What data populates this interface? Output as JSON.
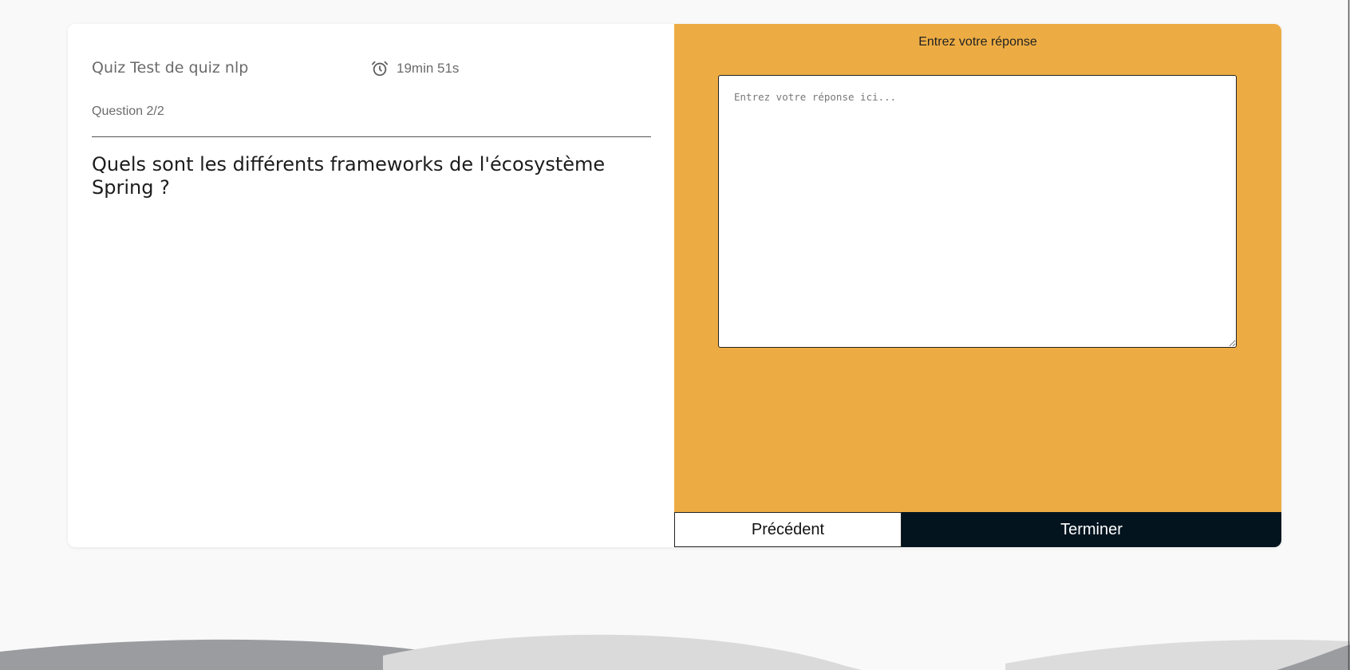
{
  "quiz": {
    "title": "Quiz Test de quiz nlp",
    "timer": "19min 51s",
    "question_counter": "Question 2/2",
    "question_text": "Quels sont les différents frameworks de l'écosystème Spring ?"
  },
  "answer": {
    "heading": "Entrez votre réponse",
    "placeholder": "Entrez votre réponse ici...",
    "value": ""
  },
  "buttons": {
    "previous_label": "Précédent",
    "finish_label": "Terminer"
  },
  "icons": {
    "timer": "alarm-clock-icon"
  },
  "colors": {
    "accent": "#edac43",
    "dark": "#03141f",
    "background": "#f9f9f9"
  }
}
